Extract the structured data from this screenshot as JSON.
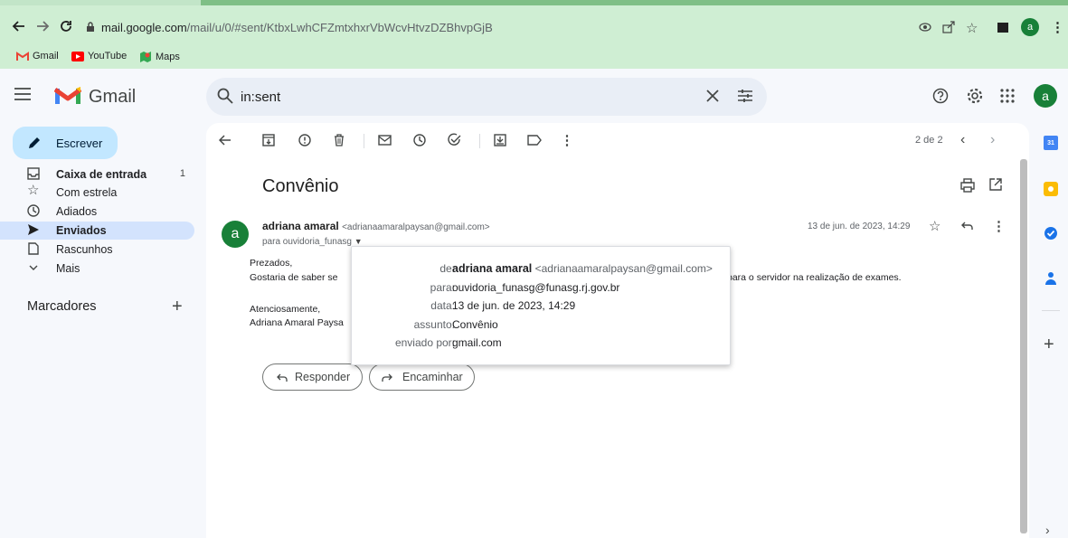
{
  "browser": {
    "url_host": "mail.google.com",
    "url_path": "/mail/u/0/#sent/KtbxLwhCFZmtxhxrVbWcvHtvzDZBhvpGjB",
    "bookmarks": [
      {
        "label": "Gmail",
        "icon": "gmail-icon"
      },
      {
        "label": "YouTube",
        "icon": "youtube-icon"
      },
      {
        "label": "Maps",
        "icon": "maps-icon"
      }
    ],
    "profile_initial": "a"
  },
  "header": {
    "app_name": "Gmail",
    "search_value": "in:sent",
    "avatar_initial": "a"
  },
  "sidebar": {
    "compose_label": "Escrever",
    "items": [
      {
        "label": "Caixa de entrada",
        "count": "1",
        "icon": "inbox-icon",
        "bold": true
      },
      {
        "label": "Com estrela",
        "count": "",
        "icon": "star-icon",
        "bold": false
      },
      {
        "label": "Adiados",
        "count": "",
        "icon": "clock-icon",
        "bold": false
      },
      {
        "label": "Enviados",
        "count": "",
        "icon": "send-icon",
        "bold": true
      },
      {
        "label": "Rascunhos",
        "count": "",
        "icon": "file-icon",
        "bold": false
      },
      {
        "label": "Mais",
        "count": "",
        "icon": "chevron-down-icon",
        "bold": false
      }
    ],
    "labels_heading": "Marcadores"
  },
  "toolbar": {
    "pagination": "2 de 2"
  },
  "message": {
    "subject": "Convênio",
    "sender_initial": "a",
    "sender_name": "adriana amaral",
    "sender_email": "<adrianaamaralpaysan@gmail.com>",
    "to_line": "para ouvidoria_funasg",
    "date": "13 de jun. de 2023, 14:29",
    "body_greeting": "Prezados,",
    "body_line1_start": "Gostaria de saber se",
    "body_line1_end": "para o servidor na realização de exames.",
    "signoff": "Atenciosamente,",
    "signature": "Adriana Amaral Paysa",
    "reply_label": "Responder",
    "forward_label": "Encaminhar"
  },
  "details_popup": {
    "rows": [
      {
        "key": "de:",
        "name": "adriana amaral",
        "value": "<adrianaamaralpaysan@gmail.com>"
      },
      {
        "key": "para:",
        "value": "ouvidoria_funasg@funasg.rj.gov.br"
      },
      {
        "key": "data:",
        "value": "13 de jun. de 2023, 14:29"
      },
      {
        "key": "assunto:",
        "value": "Convênio"
      },
      {
        "key": "enviado por:",
        "value": "gmail.com"
      }
    ]
  },
  "colors": {
    "chrome_bg": "#cfeed3",
    "compose_bg": "#c2e7ff",
    "selected_nav": "#d3e3fd",
    "avatar": "#188038",
    "gmail_red": "#ea4335"
  }
}
